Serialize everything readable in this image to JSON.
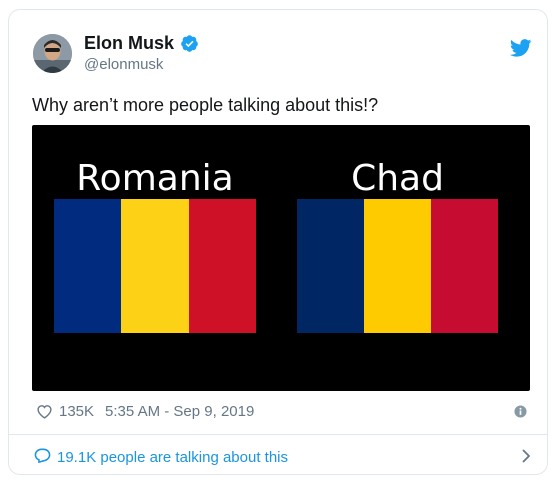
{
  "tweet": {
    "author_name": "Elon Musk",
    "author_handle": "@elonmusk",
    "text": "Why aren’t more people talking about this!?",
    "likes": "135K",
    "timestamp": "5:35 AM - Sep 9, 2019",
    "conversation_link": "19.1K people are talking about this"
  },
  "media": {
    "flags": [
      {
        "name": "Romania",
        "stripes": [
          "#002B7F",
          "#FCD116",
          "#CE1126"
        ]
      },
      {
        "name": "Chad",
        "stripes": [
          "#002664",
          "#FECB00",
          "#C60C30"
        ]
      }
    ],
    "background": "#000000"
  },
  "colors": {
    "accent": "#1da1f2",
    "link": "#1b95e0",
    "secondary_text": "#657786",
    "border": "#e1e8ed"
  },
  "icons": {
    "verified": "verified-badge-icon",
    "brand": "twitter-bird-icon",
    "like": "heart-icon",
    "info": "info-icon",
    "conversation": "speech-bubble-icon",
    "chevron": "chevron-right-icon"
  }
}
